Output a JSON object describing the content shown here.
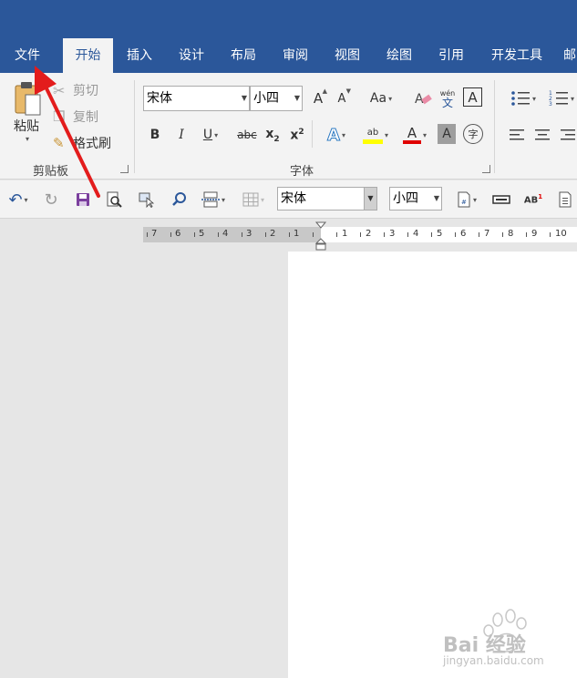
{
  "tabs": {
    "file": "文件",
    "home": "开始",
    "insert": "插入",
    "design": "设计",
    "layout": "布局",
    "review": "审阅",
    "view": "视图",
    "draw": "绘图",
    "references": "引用",
    "developer": "开发工具",
    "mail": "邮"
  },
  "clipboard": {
    "paste": "粘贴",
    "cut": "剪切",
    "copy": "复制",
    "format_painter": "格式刷",
    "group_label": "剪贴板"
  },
  "font": {
    "font_name": "宋体",
    "font_size": "小四",
    "grow": "A",
    "shrink": "A",
    "change_case": "Aa",
    "pinyin_top": "wén",
    "pinyin_bottom": "文",
    "border_char": "A",
    "bold": "B",
    "italic": "I",
    "underline": "U",
    "strike": "abc",
    "subscript": "x",
    "subscript_sub": "2",
    "superscript": "x",
    "superscript_sup": "2",
    "text_effects": "A",
    "highlight": "ab",
    "font_color": "A",
    "char_shading": "A",
    "enclose": "字",
    "group_label": "字体"
  },
  "qat": {
    "font_name": "宋体",
    "font_size": "小四",
    "ab": "AB"
  },
  "ruler": {
    "left_numbers": [
      "7",
      "6",
      "5",
      "4",
      "3",
      "2",
      "1"
    ],
    "right_numbers": [
      "1",
      "2",
      "3",
      "4",
      "5",
      "6",
      "7",
      "8",
      "9",
      "10"
    ]
  },
  "watermark": {
    "brand": "Bai 经验",
    "url": "jingyan.baidu.com"
  },
  "colors": {
    "accent": "#2b579a",
    "highlight": "#ffff00",
    "font_color": "#e00000",
    "arrow": "#e31c1c"
  }
}
